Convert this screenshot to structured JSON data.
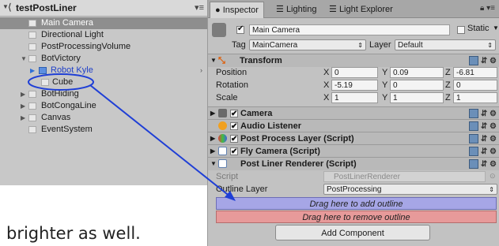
{
  "hierarchy": {
    "scene_name": "testPostLiner",
    "menu_icon": "hamburger-menu-icon",
    "items": [
      {
        "label": "Main Camera",
        "selected": true
      },
      {
        "label": "Directional Light"
      },
      {
        "label": "PostProcessingVolume"
      },
      {
        "label": "BotVictory"
      },
      {
        "label": "Robot Kyle"
      },
      {
        "label": "Cube"
      },
      {
        "label": "BotHiding"
      },
      {
        "label": "BotCongaLine"
      },
      {
        "label": "Canvas"
      },
      {
        "label": "EventSystem"
      }
    ]
  },
  "inspector": {
    "tabs": [
      {
        "label": "Inspector",
        "icon": "info-icon"
      },
      {
        "label": "Lighting",
        "icon": "lighting-icon"
      },
      {
        "label": "Light Explorer",
        "icon": "lighting-icon"
      }
    ],
    "object": {
      "name": "Main Camera",
      "static_label": "Static",
      "tag_label": "Tag",
      "tag_value": "MainCamera",
      "layer_label": "Layer",
      "layer_value": "Default"
    },
    "transform": {
      "title": "Transform",
      "rows": [
        {
          "label": "Position",
          "x": "0",
          "y": "0.09",
          "z": "-6.81"
        },
        {
          "label": "Rotation",
          "x": "-5.19",
          "y": "0",
          "z": "0"
        },
        {
          "label": "Scale",
          "x": "1",
          "y": "1",
          "z": "1"
        }
      ],
      "axis": {
        "x": "X",
        "y": "Y",
        "z": "Z"
      }
    },
    "components": [
      {
        "title": "Camera"
      },
      {
        "title": "Audio Listener"
      },
      {
        "title": "Post Process Layer (Script)"
      },
      {
        "title": "Fly Camera (Script)"
      },
      {
        "title": "Post Liner Renderer (Script)"
      }
    ],
    "renderer": {
      "script_label": "Script",
      "script_value": "PostLinerRenderer",
      "outline_layer_label": "Outline Layer",
      "outline_layer_value": "PostProcessing",
      "add_outline": "Drag here to add outline",
      "remove_outline": "Drag here to remove outline"
    },
    "add_component": "Add Component"
  },
  "caption": "brighter as well.",
  "colors": {
    "selection": "#8e8e8e",
    "add_zone": "#a6a6e6",
    "remove_zone": "#e79a9a",
    "annotation": "#1f3fd6"
  }
}
